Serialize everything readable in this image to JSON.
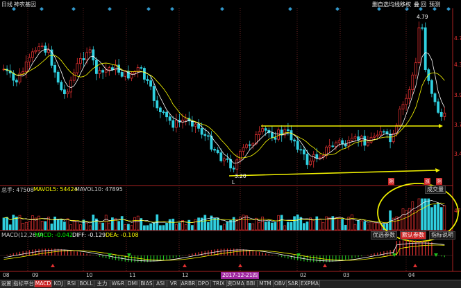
{
  "header": {
    "period": "日线",
    "stock_name": "神农基因",
    "toolbar": [
      "删自选",
      "均线",
      "移权",
      "叠",
      "回",
      "预测"
    ]
  },
  "colors": {
    "up": "#e03030",
    "down": "#30d0e0",
    "yellow": "#f0f000",
    "ma_white": "#ffffff",
    "accent": "#c22020",
    "date_box": "#a028a0"
  },
  "price_annotations": {
    "high": "4.79",
    "low": "3.20",
    "low_marker": "L"
  },
  "markers": {
    "marker1": "阴",
    "marker2": "涨",
    "marker3": "阴"
  },
  "volume_header": {
    "total": "总手: 47508",
    "mavol5": "MAVOL5: 54424",
    "mavol10": "MAVOL10: 47895"
  },
  "macd_header": {
    "name": "MACD(12,26,9)",
    "macd": "MACD: -0.042",
    "diff": "DIFF: -0.129",
    "dea": "DEA: -0.108"
  },
  "panel_buttons": {
    "volume_label": "成交量",
    "select_params": "优选参数",
    "default_params": "默认参数",
    "indicator_usage": "指标说明"
  },
  "date_tag": "2017-12-21四",
  "x_labels": [
    "08",
    "09",
    "10",
    "11",
    "12",
    "02",
    "03",
    "04"
  ],
  "tabs": [
    "设置",
    "指标平台",
    "MACD",
    "KDJ",
    "RSI",
    "BOLL",
    "主力",
    "W&R",
    "DMI",
    "BIAS",
    "ASI",
    "VR",
    "ARBR",
    "DPO",
    "TRIX",
    "资DMA",
    "BBI",
    "MTM",
    "OBV",
    "SAR",
    "EXPMA"
  ],
  "active_tab": "MACD",
  "chart_data": {
    "type": "candlestick",
    "price_axis_labels": [
      "4.7",
      "4.3",
      "3.9",
      "3.7",
      "3.4"
    ],
    "volume_axis_labels": [
      "47"
    ],
    "support_line": "3.20 bottom trendline",
    "resistance_line": "3.72 upper trendline"
  }
}
